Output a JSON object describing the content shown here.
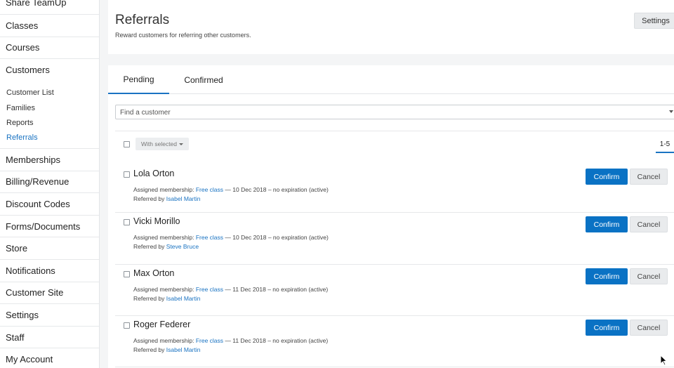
{
  "sidebar": {
    "items_top": [
      {
        "label": "Share TeamUp",
        "name": "sidebar-item-share-teamup"
      },
      {
        "label": "Classes",
        "name": "sidebar-item-classes"
      },
      {
        "label": "Courses",
        "name": "sidebar-item-courses"
      },
      {
        "label": "Customers",
        "name": "sidebar-item-customers"
      }
    ],
    "customers_sub": [
      {
        "label": "Customer List",
        "name": "sidebar-subitem-customer-list"
      },
      {
        "label": "Families",
        "name": "sidebar-subitem-families"
      },
      {
        "label": "Reports",
        "name": "sidebar-subitem-reports"
      },
      {
        "label": "Referrals",
        "name": "sidebar-subitem-referrals",
        "active": true
      }
    ],
    "items_bottom": [
      {
        "label": "Memberships",
        "name": "sidebar-item-memberships"
      },
      {
        "label": "Billing/Revenue",
        "name": "sidebar-item-billing-revenue"
      },
      {
        "label": "Discount Codes",
        "name": "sidebar-item-discount-codes"
      },
      {
        "label": "Forms/Documents",
        "name": "sidebar-item-forms-documents"
      },
      {
        "label": "Store",
        "name": "sidebar-item-store"
      },
      {
        "label": "Notifications",
        "name": "sidebar-item-notifications"
      },
      {
        "label": "Customer Site",
        "name": "sidebar-item-customer-site"
      },
      {
        "label": "Settings",
        "name": "sidebar-item-settings"
      },
      {
        "label": "Staff",
        "name": "sidebar-item-staff"
      },
      {
        "label": "My Account",
        "name": "sidebar-item-my-account"
      }
    ]
  },
  "header": {
    "title": "Referrals",
    "subtitle": "Reward customers for referring other customers.",
    "settings_label": "Settings"
  },
  "tabs": [
    {
      "label": "Pending",
      "active": true
    },
    {
      "label": "Confirmed",
      "active": false
    }
  ],
  "search": {
    "placeholder": "Find a customer",
    "value": ""
  },
  "bulk": {
    "with_selected_label": "With selected"
  },
  "pagination": {
    "label": "1-5"
  },
  "referrals": [
    {
      "name": "Lola Orton",
      "membership_prefix": "Assigned membership: ",
      "membership_link": "Free class",
      "membership_suffix": " — 10 Dec 2018 – no expiration (active)",
      "referred_prefix": "Referred by ",
      "referred_by": "Isabel Martin",
      "confirm_label": "Confirm",
      "cancel_label": "Cancel"
    },
    {
      "name": "Vicki Morillo",
      "membership_prefix": "Assigned membership: ",
      "membership_link": "Free class",
      "membership_suffix": " — 10 Dec 2018 – no expiration (active)",
      "referred_prefix": "Referred by ",
      "referred_by": "Steve Bruce",
      "confirm_label": "Confirm",
      "cancel_label": "Cancel"
    },
    {
      "name": "Max Orton",
      "membership_prefix": "Assigned membership: ",
      "membership_link": "Free class",
      "membership_suffix": " — 11 Dec 2018 – no expiration (active)",
      "referred_prefix": "Referred by ",
      "referred_by": "Isabel Martin",
      "confirm_label": "Confirm",
      "cancel_label": "Cancel"
    },
    {
      "name": "Roger Federer",
      "membership_prefix": "Assigned membership: ",
      "membership_link": "Free class",
      "membership_suffix": " — 11 Dec 2018 – no expiration (active)",
      "referred_prefix": "Referred by ",
      "referred_by": "Isabel Martin",
      "confirm_label": "Confirm",
      "cancel_label": "Cancel"
    }
  ],
  "colors": {
    "accent": "#1a73c2",
    "confirm_bg": "#0a72c4",
    "page_bg": "#f4f5f6"
  },
  "icons": {
    "cursor": "mouse-pointer-icon"
  }
}
